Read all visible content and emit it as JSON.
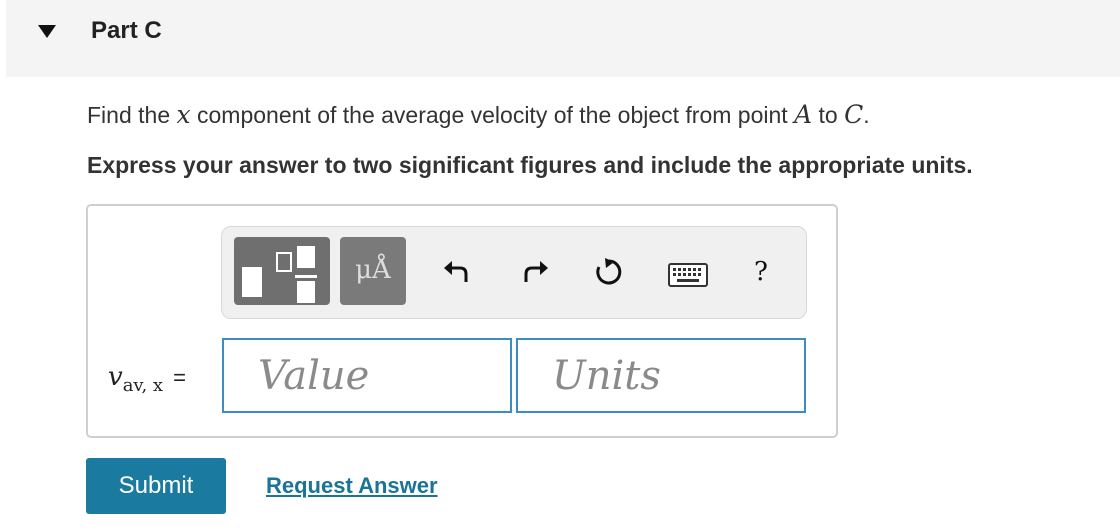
{
  "part": {
    "title": "Part C"
  },
  "question": {
    "prefix": "Find the ",
    "var_x": "x",
    "middle": " component of the average velocity of the object from point ",
    "point_a": "A",
    "to": " to ",
    "point_c": "C",
    "suffix": "."
  },
  "instruction": "Express your answer to two significant figures and include the appropriate units.",
  "toolbar": {
    "units_glyph": "μÅ",
    "help_label": "?",
    "icons": [
      "templates-icon",
      "units-icon",
      "undo-icon",
      "redo-icon",
      "reset-icon",
      "keyboard-icon",
      "help-icon"
    ]
  },
  "answer": {
    "var_symbol": "v",
    "var_subscript": "av, x",
    "equals": "=",
    "value_placeholder": "Value",
    "units_placeholder": "Units"
  },
  "actions": {
    "submit_label": "Submit",
    "request_label": "Request Answer"
  },
  "colors": {
    "accent": "#1b7aa0",
    "field_border": "#3d8cc2",
    "link": "#1a7398"
  }
}
